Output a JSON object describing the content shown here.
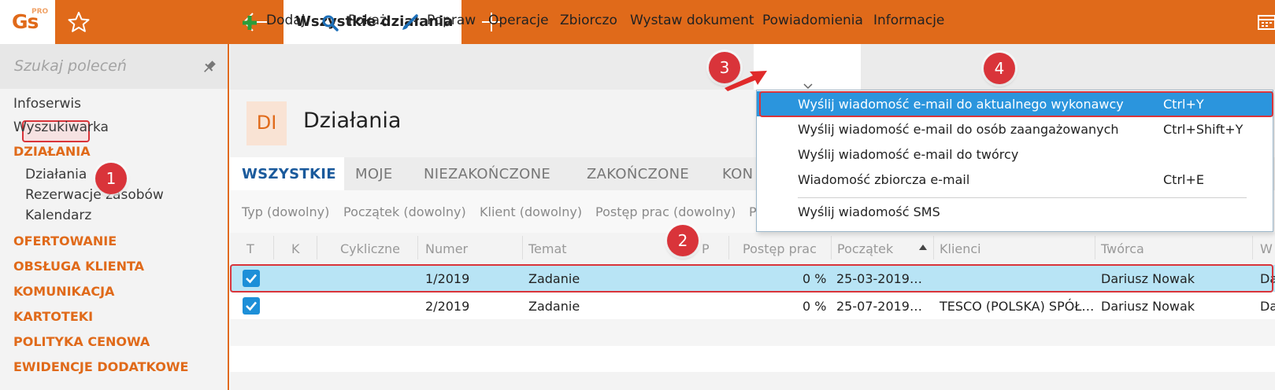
{
  "app": {
    "logo": "Gs",
    "logo_badge": "PRO",
    "active_tab": "Wszystkie działania"
  },
  "sidebar": {
    "search_placeholder": "Szukaj poleceń",
    "items": [
      {
        "label": "Infoserwis",
        "type": "item"
      },
      {
        "label": "Wyszukiwarka",
        "type": "item"
      },
      {
        "label": "DZIAŁANIA",
        "type": "section"
      },
      {
        "label": "Działania",
        "type": "sub",
        "active": true
      },
      {
        "label": "Rezerwacje zasobów",
        "type": "sub"
      },
      {
        "label": "Kalendarz",
        "type": "sub"
      },
      {
        "label": "OFERTOWANIE",
        "type": "section"
      },
      {
        "label": "OBSŁUGA KLIENTA",
        "type": "section"
      },
      {
        "label": "KOMUNIKACJA",
        "type": "section"
      },
      {
        "label": "KARTOTEKI",
        "type": "section"
      },
      {
        "label": "POLITYKA CENOWA",
        "type": "section"
      },
      {
        "label": "EWIDENCJE DODATKOWE",
        "type": "section"
      }
    ]
  },
  "toolbar": {
    "add": "Dodaj",
    "show": "Pokaż",
    "edit": "Popraw",
    "operations": "Operacje",
    "bulk": "Zbiorczo",
    "issue_doc": "Wystaw dokument",
    "notifications": "Powiadomienia",
    "info": "Informacje"
  },
  "page": {
    "badge": "DI",
    "title": "Działania"
  },
  "tabs": [
    "WSZYSTKIE",
    "MOJE",
    "NIEZAKOŃCZONE",
    "ZAKOŃCZONE",
    "KON"
  ],
  "filters": [
    "Typ (dowolny)",
    "Początek (dowolny)",
    "Klient (dowolny)",
    "Postęp prac (dowolny)",
    "P"
  ],
  "table": {
    "columns": [
      "T",
      "K",
      "Cykliczne",
      "Numer",
      "Temat",
      "P",
      "Postęp prac",
      "Początek",
      "Klienci",
      "Twórca",
      "W"
    ],
    "rows": [
      {
        "checked": true,
        "numer": "1/2019",
        "temat": "Zadanie",
        "postep": "0 %",
        "poczatek": "25-03-2019…",
        "klienci": "",
        "tworca": "Dariusz Nowak",
        "w": "Da",
        "selected": true
      },
      {
        "checked": true,
        "numer": "2/2019",
        "temat": "Zadanie",
        "postep": "0 %",
        "poczatek": "25-07-2019…",
        "klienci": "TESCO (POLSKA) SPÓŁ…",
        "tworca": "Dariusz Nowak",
        "w": "Da",
        "selected": false
      }
    ]
  },
  "menu": {
    "items": [
      {
        "label": "Wyślij wiadomość e-mail do aktualnego wykonawcy",
        "shortcut": "Ctrl+Y",
        "highlighted": true
      },
      {
        "label": "Wyślij wiadomość e-mail do osób zaangażowanych",
        "shortcut": "Ctrl+Shift+Y"
      },
      {
        "label": "Wyślij wiadomość e-mail do twórcy",
        "shortcut": ""
      },
      {
        "label": "Wiadomość zbiorcza e-mail",
        "shortcut": "Ctrl+E"
      },
      {
        "label": "Wyślij wiadomość SMS",
        "shortcut": ""
      }
    ]
  },
  "markers": [
    "1",
    "2",
    "3",
    "4"
  ],
  "colors": {
    "brand_orange": "#e06a1a",
    "highlight_blue": "#2b95dd",
    "row_selected": "#b8e4f5",
    "annotation_red": "#d9343a",
    "tab_active": "#1a5a9c"
  },
  "icons": {
    "logo": "gs-logo",
    "favorites": "star-icon",
    "back": "arrow-left-icon",
    "new_tab": "plus-icon",
    "calendar": "calendar-icon",
    "pin": "pin-icon",
    "add": "plus-icon",
    "show": "search-icon",
    "edit": "brush-icon",
    "checkbox": "checkmark-icon"
  }
}
